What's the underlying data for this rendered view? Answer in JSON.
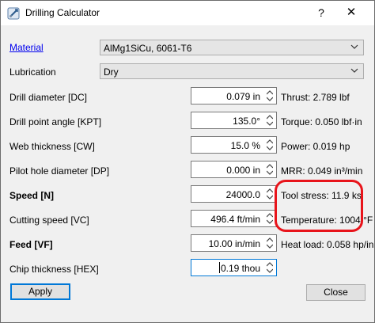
{
  "window": {
    "title": "Drilling Calculator",
    "help_glyph": "?",
    "close_glyph": "✕"
  },
  "material": {
    "label": "Material",
    "value": "AlMg1SiCu, 6061-T6"
  },
  "lubrication": {
    "label": "Lubrication",
    "value": "Dry"
  },
  "inputs": [
    {
      "label": "Drill diameter [DC]",
      "value": "0.079 in",
      "result": "Thrust: 2.789 lbf"
    },
    {
      "label": "Drill point angle [KPT]",
      "value": "135.0°",
      "result": "Torque: 0.050 lbf·in"
    },
    {
      "label": "Web thickness [CW]",
      "value": "15.0 %",
      "result": "Power: 0.019 hp"
    },
    {
      "label": "Pilot hole diameter [DP]",
      "value": "0.000 in",
      "result": "MRR: 0.049 in³/min"
    },
    {
      "label": "Speed [N]",
      "value": "24000.0",
      "result": "Tool stress: 11.9 ksi"
    },
    {
      "label": "Cutting speed [VC]",
      "value": "496.4 ft/min",
      "result": "Temperature: 1004 °F"
    },
    {
      "label": "Feed [VF]",
      "value": "10.00 in/min",
      "result": "Heat load: 0.058 hp/in"
    },
    {
      "label": "Chip thickness [HEX]",
      "value": "0.19 thou",
      "result": ""
    }
  ],
  "buttons": {
    "apply": "Apply",
    "close": "Close"
  },
  "colors": {
    "accent": "#0078d7",
    "highlight": "#e8141b",
    "link": "#0000ee"
  }
}
